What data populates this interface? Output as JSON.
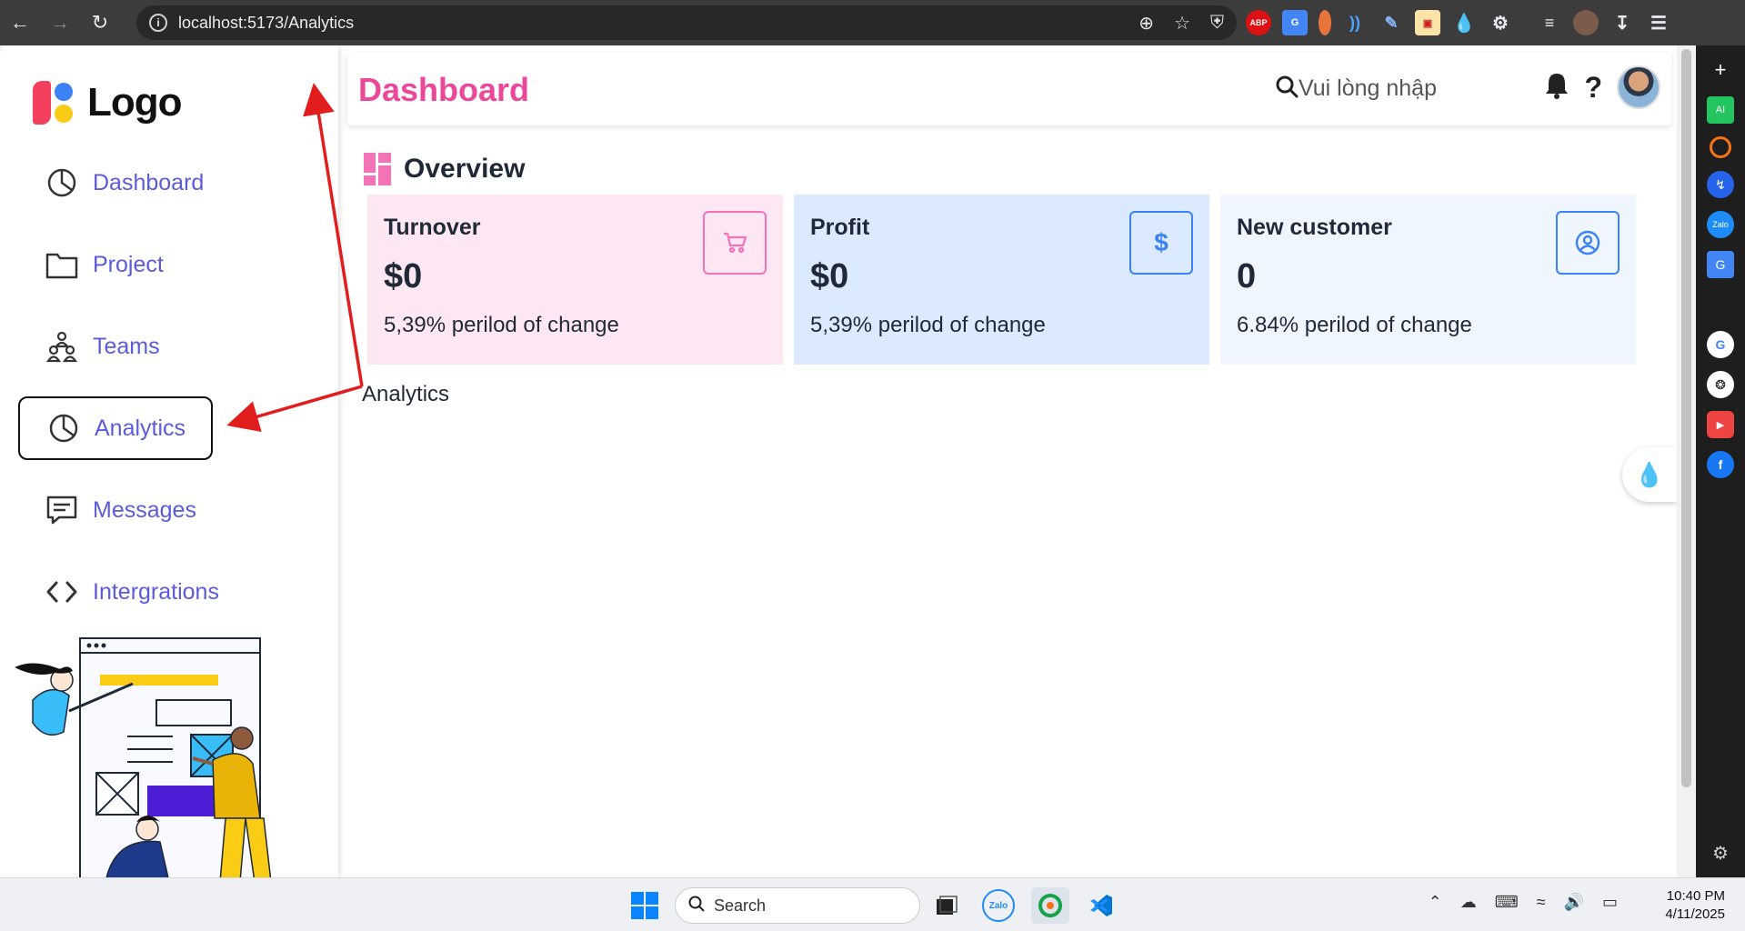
{
  "browser": {
    "url": "localhost:5173/Analytics"
  },
  "sidebar": {
    "logo_text": "Logo",
    "items": [
      {
        "label": "Dashboard",
        "icon": "pie-chart-icon"
      },
      {
        "label": "Project",
        "icon": "folder-icon"
      },
      {
        "label": "Teams",
        "icon": "team-icon"
      },
      {
        "label": "Analytics",
        "icon": "pie-chart-icon",
        "active": true
      },
      {
        "label": "Messages",
        "icon": "message-icon"
      },
      {
        "label": "Intergrations",
        "icon": "code-icon"
      }
    ]
  },
  "header": {
    "title": "Dashboard",
    "search_placeholder": "Vui lòng nhập",
    "help_label": "?"
  },
  "overview": {
    "title": "Overview",
    "cards": [
      {
        "title": "Turnover",
        "value": "$0",
        "change": "5,39% perilod of change",
        "icon": "cart-icon",
        "bg": "#fce7f3",
        "accent": "#f472b6"
      },
      {
        "title": "Profit",
        "value": "$0",
        "change": "5,39% perilod of change",
        "icon": "dollar-icon",
        "icon_text": "$",
        "bg": "#dbeafe",
        "accent": "#3b82f6"
      },
      {
        "title": "New customer",
        "value": "0",
        "change": "6.84% perilod of change",
        "icon": "user-circle-icon",
        "bg": "#eff6ff",
        "accent": "#3b82f6"
      }
    ]
  },
  "content": {
    "section_label": "Analytics"
  },
  "taskbar": {
    "search_label": "Search",
    "zalo_label": "Zalo",
    "time": "10:40 PM",
    "date": "4/11/2025"
  },
  "colors": {
    "accent_pink": "#ec4899",
    "menu_text": "#5b5bdb",
    "annotation_red": "#e11d1d"
  }
}
